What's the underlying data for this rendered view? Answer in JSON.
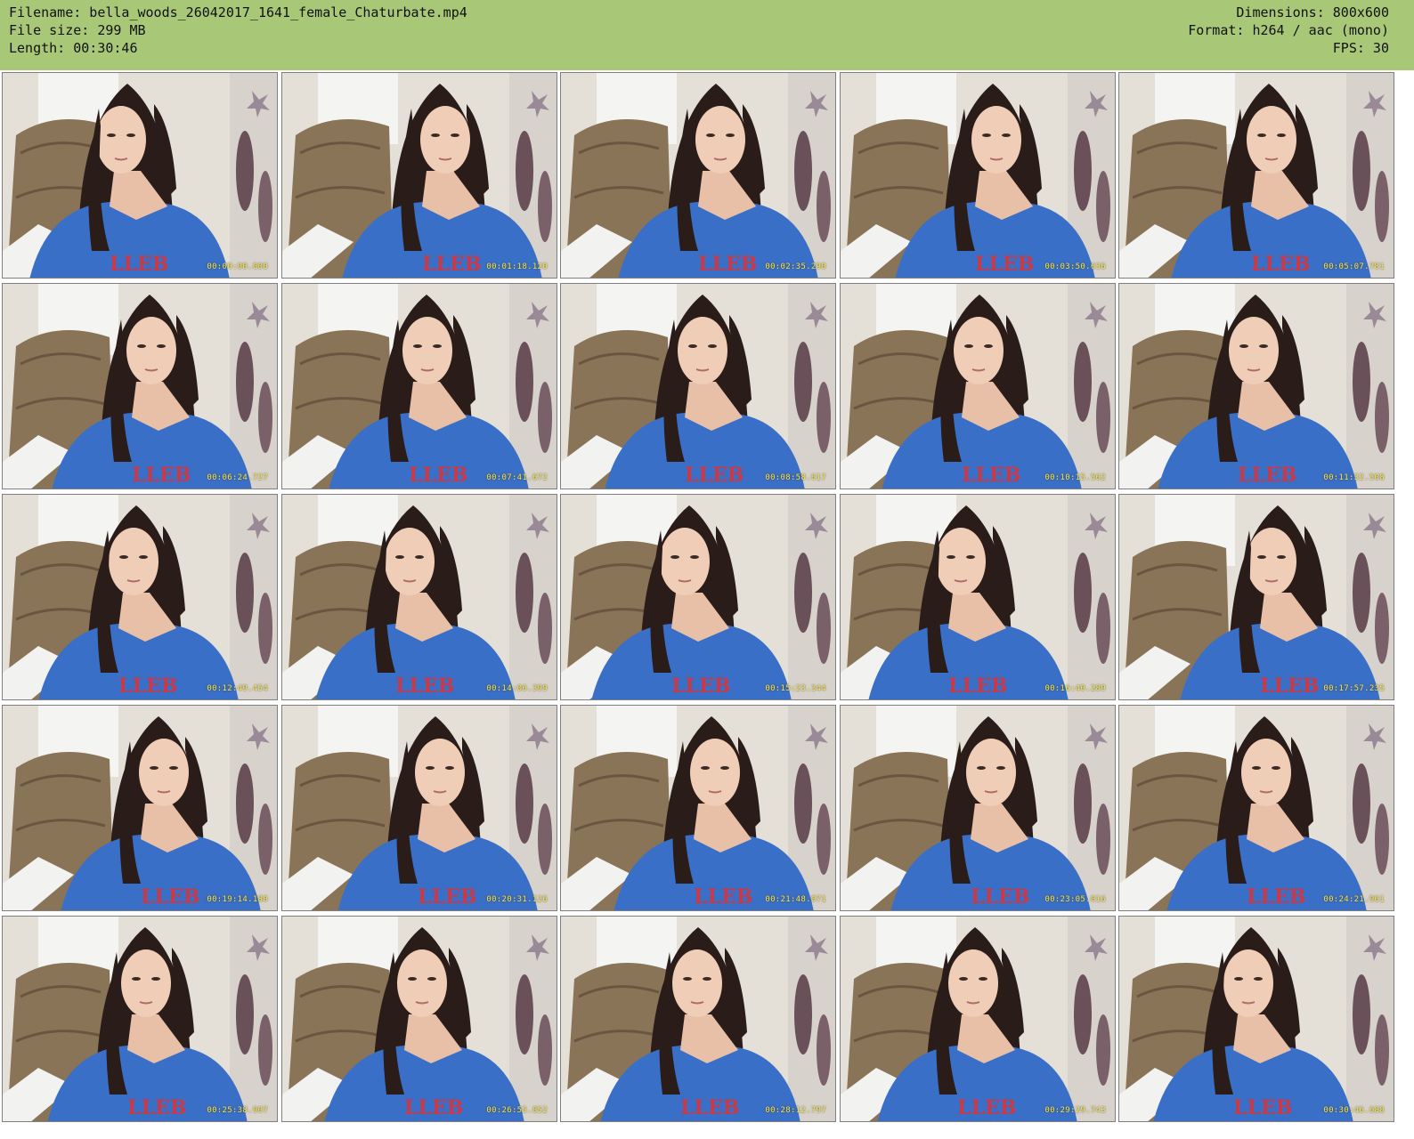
{
  "header": {
    "filename_line": "Filename: bella_woods_26042017_1641_female_Chaturbate.mp4",
    "filesize_line": "File size: 299 MB",
    "length_line": "Length: 00:30:46",
    "dimensions_line": "Dimensions: 800x600",
    "format_line": "Format: h264 / aac (mono)",
    "fps_line": "FPS: 30"
  },
  "colors": {
    "header_bg": "#a8c878",
    "shirt": "#3a6fc8",
    "hair": "#2a1c18",
    "chair": "#8a7458",
    "wall": "#e4e0d8"
  },
  "thumbnails": [
    {
      "timestamp": "00:00:00.000"
    },
    {
      "timestamp": "00:01:18.120"
    },
    {
      "timestamp": "00:02:35.290"
    },
    {
      "timestamp": "00:03:50.636"
    },
    {
      "timestamp": "00:05:07.781"
    },
    {
      "timestamp": "00:06:24.727"
    },
    {
      "timestamp": "00:07:41.672"
    },
    {
      "timestamp": "00:08:58.617"
    },
    {
      "timestamp": "00:10:15.562"
    },
    {
      "timestamp": "00:11:32.508"
    },
    {
      "timestamp": "00:12:49.454"
    },
    {
      "timestamp": "00:14:06.399"
    },
    {
      "timestamp": "00:15:23.344"
    },
    {
      "timestamp": "00:16:40.289"
    },
    {
      "timestamp": "00:17:57.235"
    },
    {
      "timestamp": "00:19:14.180"
    },
    {
      "timestamp": "00:20:31.126"
    },
    {
      "timestamp": "00:21:48.071"
    },
    {
      "timestamp": "00:23:05.016"
    },
    {
      "timestamp": "00:24:21.961"
    },
    {
      "timestamp": "00:25:38.907"
    },
    {
      "timestamp": "00:26:55.852"
    },
    {
      "timestamp": "00:28:12.797"
    },
    {
      "timestamp": "00:29:29.743"
    },
    {
      "timestamp": "00:30:46.688"
    }
  ]
}
